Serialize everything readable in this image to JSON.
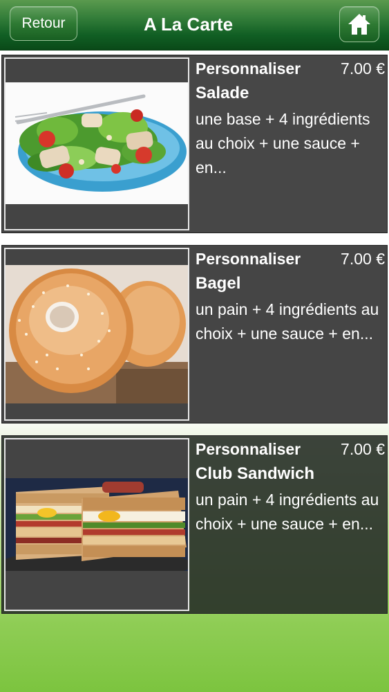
{
  "header": {
    "back_label": "Retour",
    "title": "A La Carte",
    "home_icon": "home-icon"
  },
  "items": [
    {
      "customize_label": "Personnaliser",
      "price": "7.00 €",
      "name": "Salade",
      "description": "une base + 4 ingrédients au choix + une sauce + en..."
    },
    {
      "customize_label": "Personnaliser",
      "price": "7.00 €",
      "name": "Bagel",
      "description": "un pain + 4 ingrédients au choix + une sauce + en..."
    },
    {
      "customize_label": "Personnaliser",
      "price": "7.00 €",
      "name": "Club Sandwich",
      "description": "un pain + 4 ingrédients au choix + une sauce + en..."
    }
  ],
  "colors": {
    "header_green": "#115f24",
    "card_bg": "#474747",
    "text": "#ffffff",
    "background_green": "#7cc43f"
  }
}
